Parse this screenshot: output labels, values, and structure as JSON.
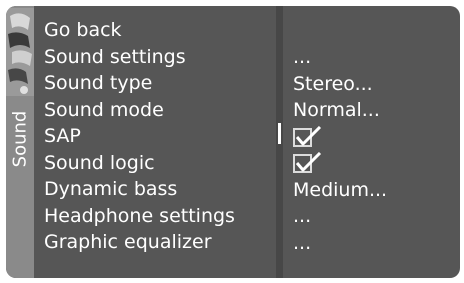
{
  "sidebar": {
    "title": "Sound",
    "emblem_icon": "sound-emblem-icon"
  },
  "menu": {
    "items": [
      {
        "label": "Go back"
      },
      {
        "label": "Sound settings",
        "value": "..."
      },
      {
        "label": "Sound type",
        "value": "Stereo..."
      },
      {
        "label": "Sound mode",
        "value": "Normal..."
      },
      {
        "label": "SAP",
        "checked": true
      },
      {
        "label": "Sound logic",
        "checked": true
      },
      {
        "label": "Dynamic bass",
        "value": "Medium..."
      },
      {
        "label": "Headphone settings",
        "value": "..."
      },
      {
        "label": "Graphic equalizer",
        "value": "..."
      }
    ]
  },
  "colors": {
    "panel": "#565656",
    "sidebar": "#8a8a8a",
    "divider": "#474747",
    "text": "#ffffff"
  }
}
